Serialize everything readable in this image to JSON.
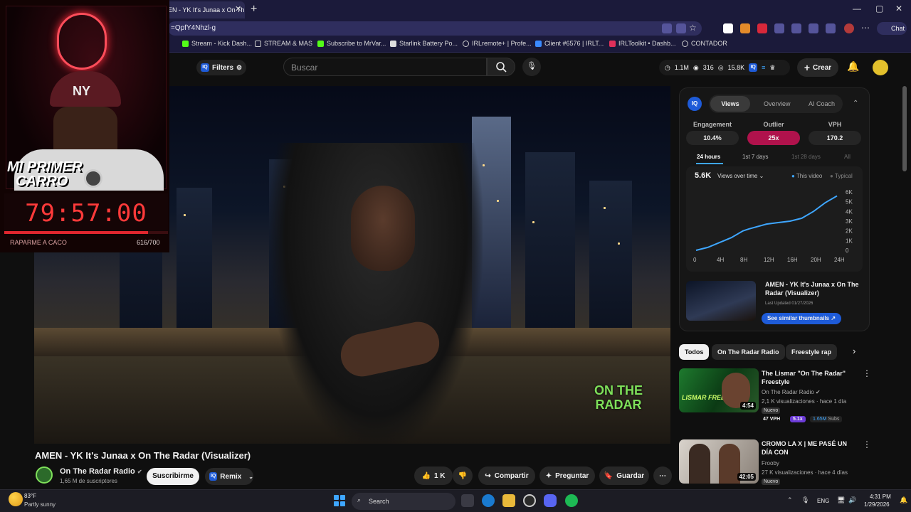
{
  "browser": {
    "tab_title": "EN - YK It's Junaa x On Th",
    "address": "=QpfY4Nhzl-g",
    "bookmarks": [
      "Stream - Kick Dash...",
      "STREAM & MAS",
      "Subscribe to MrVar...",
      "Starlink Battery Po...",
      "IRLremote+ | Profe...",
      "Client #6576 | IRLT...",
      "IRLToolkit • Dashb...",
      "CONTADOR"
    ]
  },
  "header": {
    "filters_label": "Filters",
    "search_placeholder": "Buscar",
    "stats": [
      "1.1M",
      "316",
      "15.8K"
    ],
    "create_label": "Crear"
  },
  "overlay": {
    "cap_text": "NY",
    "title_line1": "MI PRIMER",
    "title_line2": "CARRO",
    "timer": "79:57:00",
    "goal_label": "RAPARME A CACO",
    "goal_count": "616/700",
    "goal_progress": 0.88
  },
  "video": {
    "title": "AMEN - YK It's Junaa x On The Radar (Visualizer)",
    "watermark_line1": "ON THE",
    "watermark_line2": "RADAR",
    "channel": "On The Radar Radio",
    "subscribers": "1,65 M de suscriptores",
    "subscribe_label": "Suscribirme",
    "remix_label": "Remix",
    "likes": "1 K",
    "share_label": "Compartir",
    "ask_label": "Preguntar",
    "save_label": "Guardar"
  },
  "panel": {
    "tabs": [
      "Views",
      "Overview",
      "AI Coach"
    ],
    "metrics": [
      {
        "label": "Engagement",
        "value": "10.4%"
      },
      {
        "label": "Outlier",
        "value": "25x"
      },
      {
        "label": "VPH",
        "value": "170.2"
      }
    ],
    "ranges": [
      "24 hours",
      "1st 7 days",
      "1st 28 days",
      "All"
    ],
    "total": "5.6K",
    "dropdown": "Views over time",
    "legend_this": "This video",
    "legend_typical": "Typical",
    "thumb_title": "AMEN - YK It's Junaa x On The Radar (Visualizer)",
    "last_updated": "Last Updated 01/27/2026",
    "similar_label": "See similar thumbnails ↗"
  },
  "chart_data": {
    "type": "line",
    "x": [
      "0",
      "4H",
      "8H",
      "12H",
      "16H",
      "20H",
      "24H"
    ],
    "yticks": [
      "0",
      "1K",
      "2K",
      "3K",
      "4K",
      "5K",
      "6K"
    ],
    "ylim": [
      0,
      6000
    ],
    "series": [
      {
        "name": "This video",
        "points": [
          [
            0,
            0
          ],
          [
            2,
            300
          ],
          [
            4,
            800
          ],
          [
            6,
            1300
          ],
          [
            8,
            2000
          ],
          [
            9,
            2200
          ],
          [
            12,
            2700
          ],
          [
            14,
            2850
          ],
          [
            16,
            3000
          ],
          [
            18,
            3300
          ],
          [
            20,
            4000
          ],
          [
            22,
            4900
          ],
          [
            24,
            5600
          ]
        ]
      }
    ]
  },
  "chips": [
    "Todos",
    "On The Radar Radio",
    "Freestyle rap"
  ],
  "recommended": [
    {
      "title": "The Lismar \"On The Radar\" Freestyle",
      "channel": "On The Radar Radio",
      "meta": "2,1 K visualizaciones · hace 1 día",
      "badge": "Nuevo",
      "duration": "4:54",
      "thumb_text": "LISMAR FREESTYLE",
      "vph": "47 VPH",
      "outlier": "5.1x",
      "subs": "1.65M",
      "subs_label": "Subs"
    },
    {
      "title": "CROMO LA X | ME PASÉ UN DÍA CON",
      "channel": "Frooby",
      "meta": "27 K visualizaciones · hace 4 días",
      "badge": "Nuevo",
      "duration": "42:05"
    }
  ],
  "taskbar": {
    "temp": "83°F",
    "weather": "Partly sunny",
    "search": "Search",
    "lang": "ENG",
    "time": "4:31 PM",
    "date": "1/29/2026"
  }
}
